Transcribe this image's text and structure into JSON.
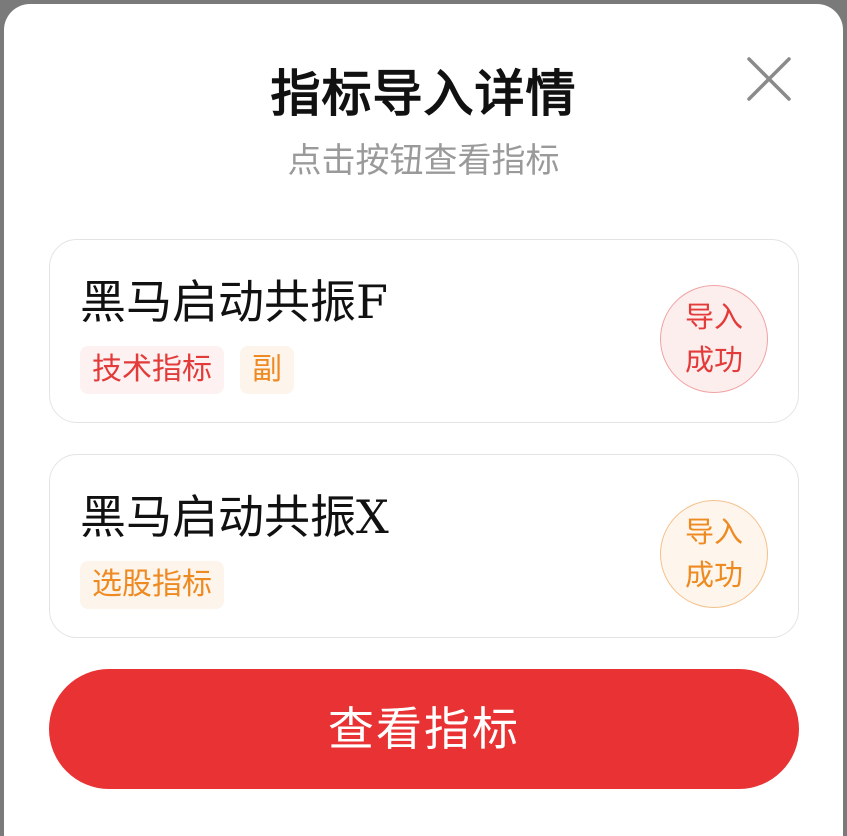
{
  "dialog": {
    "title": "指标导入详情",
    "subtitle": "点击按钮查看指标",
    "close_icon": "close-icon"
  },
  "indicators": [
    {
      "name": "黑马启动共振F",
      "tags": [
        "技术指标",
        "副"
      ],
      "status_line1": "导入",
      "status_line2": "成功",
      "status_color": "#e33a3a"
    },
    {
      "name": "黑马启动共振X",
      "tags": [
        "选股指标"
      ],
      "status_line1": "导入",
      "status_line2": "成功",
      "status_color": "#ee8a22"
    }
  ],
  "actions": {
    "view_label": "查看指标"
  },
  "colors": {
    "accent": "#e83234",
    "tag_red": "#e33a3a",
    "tag_orange": "#ee8a22"
  }
}
